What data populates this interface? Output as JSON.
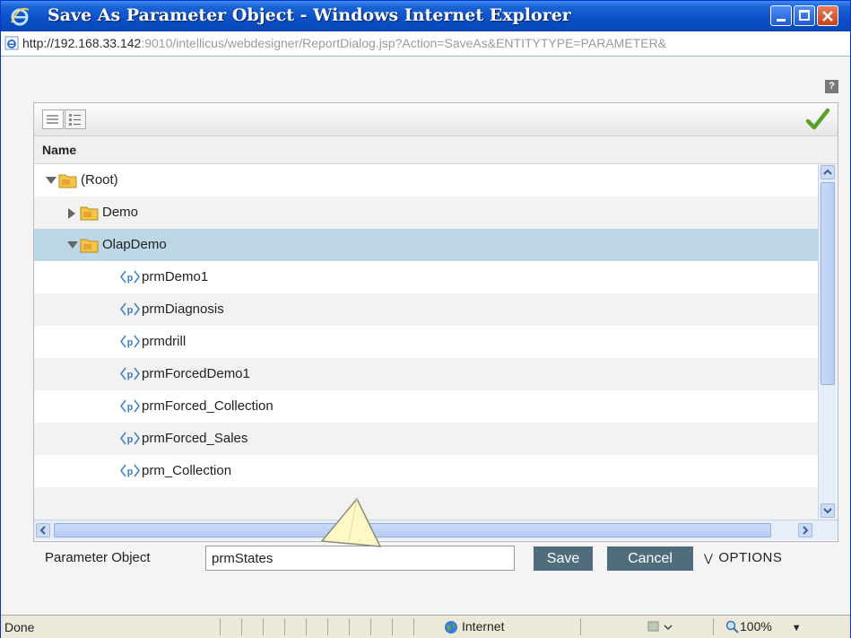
{
  "window": {
    "title": "Save As Parameter Object - Windows Internet Explorer",
    "address_host": "http://192.168.33.142",
    "address_rest": ":9010/intellicus/webdesigner/ReportDialog.jsp?Action=SaveAs&ENTITYTYPE=PARAMETER&"
  },
  "toolbar": {
    "help": "?"
  },
  "tree": {
    "column_header": "Name",
    "items": [
      {
        "label": "(Root)",
        "type": "folder",
        "expanded": true
      },
      {
        "label": "Demo",
        "type": "folder",
        "expanded": false
      },
      {
        "label": "OlapDemo",
        "type": "folder",
        "expanded": true,
        "selected": true
      },
      {
        "label": "prmDemo1",
        "type": "parameter"
      },
      {
        "label": "prmDiagnosis",
        "type": "parameter"
      },
      {
        "label": "prmdrill",
        "type": "parameter"
      },
      {
        "label": "prmForcedDemo1",
        "type": "parameter"
      },
      {
        "label": "prmForced_Collection",
        "type": "parameter"
      },
      {
        "label": "prmForced_Sales",
        "type": "parameter"
      },
      {
        "label": "prm_Collection",
        "type": "parameter"
      }
    ]
  },
  "form": {
    "label": "Parameter Object",
    "value": "prmStates",
    "save": "Save",
    "cancel": "Cancel",
    "options": "OPTIONS"
  },
  "status": {
    "text": "Done",
    "zone": "Internet",
    "zoom": "100%"
  },
  "colors": {
    "title_bar": "#0a4fc9",
    "selected_row": "#bcd7e6",
    "button": "#4f6d7a",
    "check": "#5aa02c"
  }
}
